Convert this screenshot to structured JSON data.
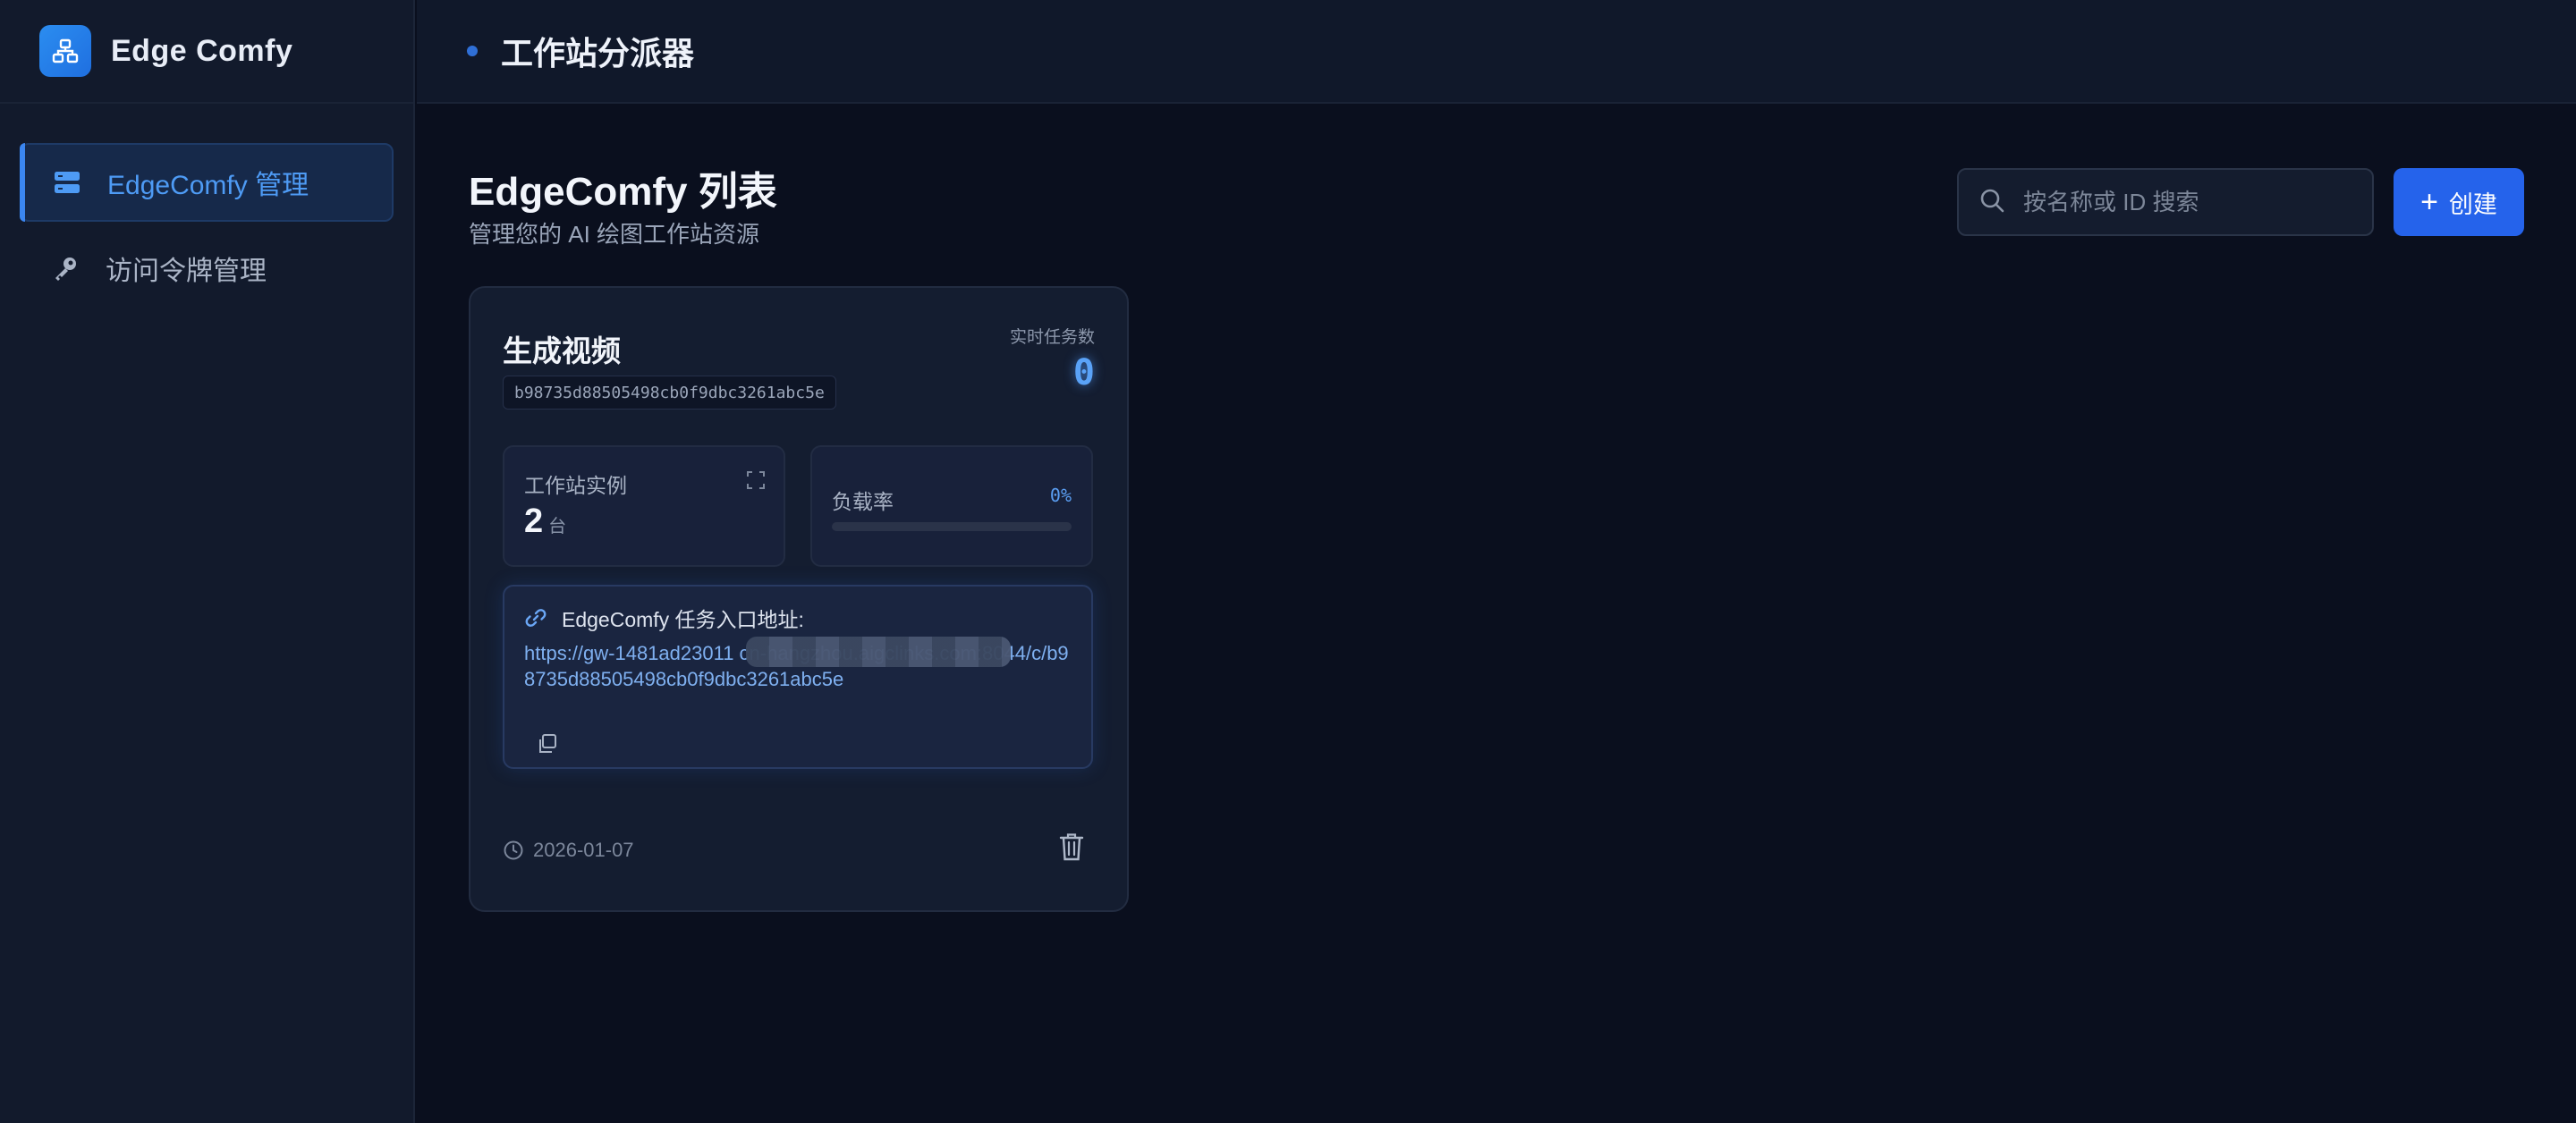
{
  "brand": {
    "name": "Edge Comfy",
    "icon": "network-icon"
  },
  "sidebar": {
    "items": [
      {
        "label": "EdgeComfy 管理",
        "icon": "server-icon",
        "active": true
      },
      {
        "label": "访问令牌管理",
        "icon": "key-icon",
        "active": false
      }
    ]
  },
  "header": {
    "title": "工作站分派器"
  },
  "page": {
    "title": "EdgeComfy 列表",
    "subtitle": "管理您的 AI 绘图工作站资源"
  },
  "search": {
    "placeholder": "按名称或 ID 搜索",
    "value": ""
  },
  "create_button": {
    "label": "创建"
  },
  "workstations": [
    {
      "name": "生成视频",
      "id": "b98735d88505498cb0f9dbc3261abc5e",
      "task_label": "实时任务数",
      "task_count": "0",
      "instances_label": "工作站实例",
      "instances_value": "2",
      "instances_unit": "台",
      "load_label": "负载率",
      "load_value": "0%",
      "load_fraction": 0,
      "url_label": "EdgeComfy 任务入口地址:",
      "url": "https://gw-1481ad23011                              cn-hangzhou.aigclinks.com:8044/c/b98735d88505498cb0f9dbc3261abc5e",
      "date": "2026-01-07"
    }
  ],
  "colors": {
    "accent": "#2563eb",
    "background": "#0a0f1e",
    "sidebar": "#121a2c"
  }
}
